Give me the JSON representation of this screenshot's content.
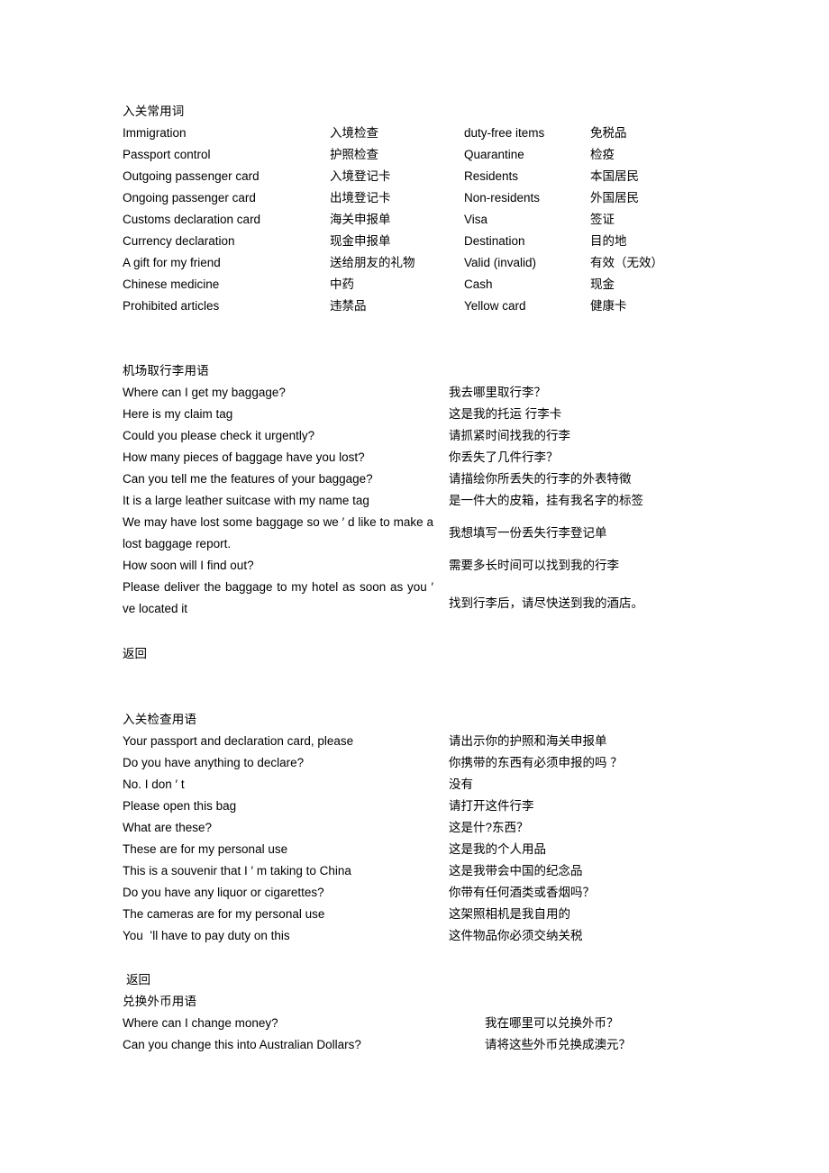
{
  "document": {
    "sections": [
      {
        "id": "customs-vocabulary",
        "title": "入关常用词",
        "type": "vocab",
        "rows": [
          {
            "en1": "Immigration",
            "zh1": "入境检查",
            "en2": "duty-free items",
            "zh2": "免税品"
          },
          {
            "en1": "Passport control",
            "zh1": "护照检查",
            "en2": "Quarantine",
            "zh2": "检疫"
          },
          {
            "en1": "Outgoing passenger card",
            "zh1": "入境登记卡",
            "en2": "Residents",
            "zh2": "本国居民"
          },
          {
            "en1": "Ongoing passenger card",
            "zh1": "出境登记卡",
            "en2": "Non-residents",
            "zh2": "外国居民"
          },
          {
            "en1": "Customs declaration card",
            "zh1": "海关申报单",
            "en2": "Visa",
            "zh2": "签证"
          },
          {
            "en1": "Currency declaration",
            "zh1": "现金申报单",
            "en2": "Destination",
            "zh2": "目的地"
          },
          {
            "en1": "A gift for my friend",
            "zh1": "送给朋友的礼物",
            "en2": "Valid (invalid)",
            "zh2": "有效（无效）"
          },
          {
            "en1": "Chinese medicine",
            "zh1": "中药",
            "en2": "Cash",
            "zh2": "现金"
          },
          {
            "en1": "Prohibited articles",
            "zh1": "违禁品",
            "en2": "Yellow card",
            "zh2": "健康卡"
          }
        ]
      },
      {
        "id": "baggage-claim",
        "title": "机场取行李用语",
        "type": "phrases",
        "rows": [
          {
            "en": "Where can I get my baggage?",
            "zh": "我去哪里取行李？",
            "wrap": false
          },
          {
            "en": "Here is my claim tag",
            "zh": "这是我的托运 行李卡",
            "wrap": false
          },
          {
            "en": "Could you please check it urgently?",
            "zh": "请抓紧时间找我的行李",
            "wrap": false
          },
          {
            "en": "How many pieces of baggage have you lost?",
            "zh": "你丢失了几件行李？",
            "wrap": false
          },
          {
            "en": "Can you tell me the features of your baggage?",
            "zh": "请描绘你所丢失的行李的外表特徵",
            "wrap": false
          },
          {
            "en": "It is a large leather suitcase with my name tag",
            "zh": "是一件大的皮箱，挂有我名字的标签",
            "wrap": false
          },
          {
            "en": "We may have lost some baggage so we ′ d like to make a lost baggage report.",
            "zh": "我想填写一份丢失行李登记单",
            "wrap": true
          },
          {
            "en": "How soon will I find out?",
            "zh": "需要多长时间可以找到我的行李",
            "wrap": false
          },
          {
            "en": "Please deliver the baggage to my hotel as soon as you ′ ve located it",
            "zh": "找到行李后，请尽快送到我的酒店。",
            "wrap": true
          }
        ],
        "back_label": "返回"
      },
      {
        "id": "customs-inspection",
        "title": "入关检查用语",
        "type": "phrases",
        "rows": [
          {
            "en": "Your passport and declaration card, please",
            "zh": "请出示你的护照和海关申报单",
            "wrap": false
          },
          {
            "en": "Do you have anything to declare?",
            "zh": "你携带的东西有必须申报的吗 ？",
            "wrap": false
          },
          {
            "en": "No. I don ′ t",
            "zh": "没有",
            "wrap": false
          },
          {
            "en": "Please open this bag",
            "zh": "请打开这件行李",
            "wrap": false
          },
          {
            "en": "What are these?",
            "zh": "这是什?东西？",
            "wrap": false
          },
          {
            "en": "These are for my personal use",
            "zh": "这是我的个人用品",
            "wrap": false
          },
          {
            "en": "This is a souvenir that I ′ m taking to China",
            "zh": "这是我带会中国的纪念品",
            "wrap": false
          },
          {
            "en": "Do you have any liquor or cigarettes?",
            "zh": "你带有任何酒类或香烟吗？",
            "wrap": false
          },
          {
            "en": "The cameras are for my personal use",
            "zh": "这架照相机是我自用的",
            "wrap": false
          },
          {
            "en": "You  ʻll have to pay duty on this",
            "zh": "这件物品你必须交纳关税",
            "wrap": false
          }
        ],
        "back_label": "返回"
      },
      {
        "id": "currency-exchange",
        "title": "兑换外币用语",
        "type": "phrases",
        "rows": [
          {
            "en": "Where can I change money?",
            "zh": "我在哪里可以兑换外币？",
            "wrap": false
          },
          {
            "en": "Can you change this into Australian Dollars?",
            "zh": "请将这些外币兑换成澳元？",
            "wrap": false
          }
        ]
      }
    ]
  }
}
